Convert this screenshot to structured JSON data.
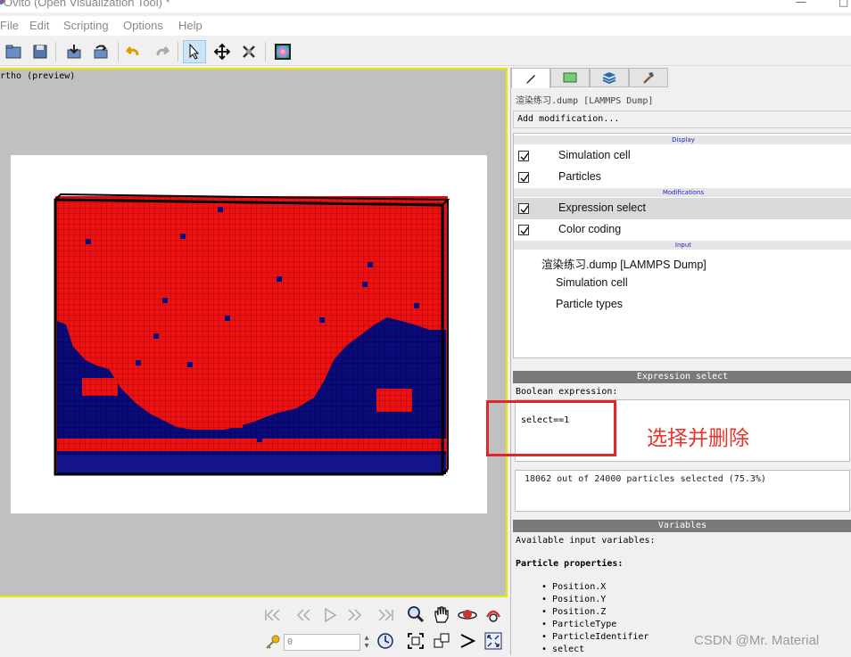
{
  "window": {
    "title": "Ovito (Open Visualization Tool) *",
    "close_glyph": "□"
  },
  "menu": {
    "items": [
      "File",
      "Edit",
      "Scripting",
      "Options",
      "Help"
    ]
  },
  "toolbar": {
    "icons": [
      "open-file-icon",
      "save-icon",
      "import-icon",
      "export-icon",
      "undo-icon",
      "redo-icon",
      "select-mode-icon",
      "move-mode-icon",
      "pick-mode-icon",
      "render-icon"
    ]
  },
  "viewport": {
    "caption": "rtho (preview)"
  },
  "colors": {
    "particle_red": "#ee1111",
    "particle_blue": "#0a0a7a",
    "viewport_border": "#e8e800",
    "annotation": "#e8332b"
  },
  "animation": {
    "frame_value": "0"
  },
  "panel": {
    "pipeline_title": "渲染练习.dump [LAMMPS Dump]",
    "add_modification": "Add modification...",
    "sections": {
      "display": "Display",
      "modifications": "Modifications",
      "input": "Input"
    },
    "display_items": [
      "Simulation cell",
      "Particles"
    ],
    "modification_items": [
      "Expression select",
      "Color coding"
    ],
    "input_title": "渲染练习.dump [LAMMPS Dump]",
    "input_items": [
      "Simulation cell",
      "Particle types"
    ],
    "expr_header": "Expression select",
    "expr_label": "Boolean expression:",
    "expr_value": "select==1",
    "status": "18062 out of 24000 particles selected (75.3%)",
    "vars_header": "Variables",
    "vars_intro": "Available input variables:",
    "vars_group": "Particle properties:",
    "vars": [
      "Position.X",
      "Position.Y",
      "Position.Z",
      "ParticleType",
      "ParticleIdentifier",
      "select"
    ]
  },
  "annotation": {
    "text": "选择并删除"
  },
  "watermark": {
    "text": "CSDN @Mr. Material"
  }
}
